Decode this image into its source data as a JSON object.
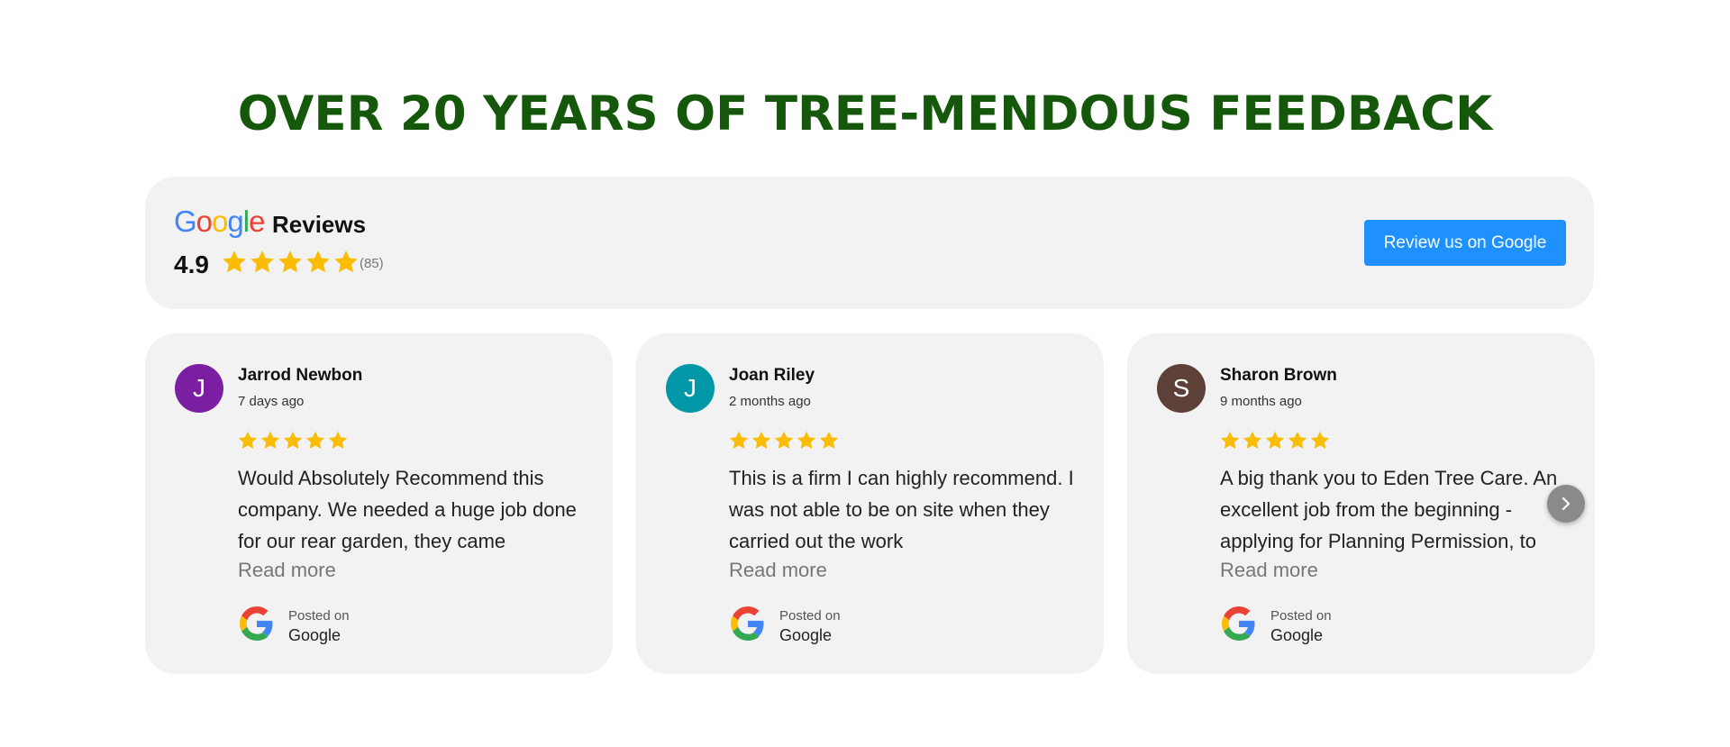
{
  "heading": "OVER 20 YEARS OF TREE-MENDOUS FEEDBACK",
  "summary": {
    "logo_text": "Google",
    "logo_colors": [
      "#4285F4",
      "#EA4335",
      "#FBBC05",
      "#4285F4",
      "#34A853",
      "#EA4335"
    ],
    "title": "Reviews",
    "rating": "4.9",
    "rating_stars": 5,
    "review_count": "(85)",
    "button_label": "Review us on Google"
  },
  "reviews": [
    {
      "initial": "J",
      "avatar_color": "#7b1fa2",
      "name": "Jarrod Newbon",
      "date": "7 days ago",
      "stars": 5,
      "text": "Would Absolutely Recommend this company. We needed a huge job done for our rear garden, they came",
      "read_more": "Read more",
      "posted_on": "Posted on",
      "site": "Google"
    },
    {
      "initial": "J",
      "avatar_color": "#0097a7",
      "name": "Joan Riley",
      "date": "2 months ago",
      "stars": 5,
      "text": "This is a firm I can highly recommend. I was not able to be on site when they carried out the work",
      "read_more": "Read more",
      "posted_on": "Posted on",
      "site": "Google"
    },
    {
      "initial": "S",
      "avatar_color": "#5d4037",
      "name": "Sharon Brown",
      "date": "9 months ago",
      "stars": 5,
      "text": "A big thank you to Eden Tree Care. An excellent job from the beginning - applying for Planning Permission, to",
      "read_more": "Read more",
      "posted_on": "Posted on",
      "site": "Google"
    }
  ],
  "colors": {
    "heading": "#15580b",
    "star": "#fbbc04",
    "button": "#1e90ff",
    "card_bg": "#f2f2f2"
  },
  "icons": {
    "star": "star-icon",
    "google": "google-g-icon",
    "next": "chevron-right-icon"
  }
}
